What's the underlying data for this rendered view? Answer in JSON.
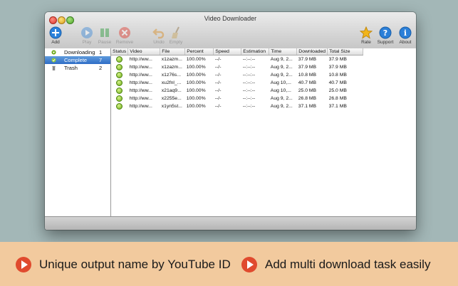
{
  "window": {
    "title": "Video Downloader"
  },
  "toolbar": {
    "add": "Add",
    "play": "Play",
    "pause": "Pause",
    "remove": "Remove",
    "undo": "Undo",
    "empty": "Empty",
    "rate": "Rate",
    "support": "Support",
    "about": "About"
  },
  "sidebar": {
    "items": [
      {
        "label": "Downloading",
        "count": "1",
        "icon": "download-status-icon"
      },
      {
        "label": "Complete",
        "count": "7",
        "icon": "complete-status-icon"
      },
      {
        "label": "Trash",
        "count": "2",
        "icon": "trash-icon"
      }
    ]
  },
  "table": {
    "columns": [
      "Status",
      "Video",
      "File",
      "Percent",
      "Speed",
      "Estimation",
      "Time",
      "Downloaded",
      "Total Size"
    ],
    "rows": [
      [
        "",
        "http://ww...",
        "x1zazm...",
        "100.00%",
        "--/-",
        "--:--:--",
        "Aug 9, 2...",
        "37.9 MB",
        "37.9 MB"
      ],
      [
        "",
        "http://ww...",
        "x1zazm...",
        "100.00%",
        "--/-",
        "--:--:--",
        "Aug 9, 2...",
        "37.9 MB",
        "37.9 MB"
      ],
      [
        "",
        "http://ww...",
        "x1z76s...",
        "100.00%",
        "--/-",
        "--:--:--",
        "Aug 9, 2...",
        "10.8 MB",
        "10.8 MB"
      ],
      [
        "",
        "http://ww...",
        "xu2fnl_...",
        "100.00%",
        "--/-",
        "--:--:--",
        "Aug 10,...",
        "40.7 MB",
        "40.7 MB"
      ],
      [
        "",
        "http://ww...",
        "x21aq9...",
        "100.00%",
        "--/-",
        "--:--:--",
        "Aug 10,...",
        "25.0 MB",
        "25.0 MB"
      ],
      [
        "",
        "http://ww...",
        "x2255e...",
        "100.00%",
        "--/-",
        "--:--:--",
        "Aug 9, 2...",
        "26.8 MB",
        "26.8 MB"
      ],
      [
        "",
        "http://ww...",
        "x1yn5st...",
        "100.00%",
        "--/-",
        "--:--:--",
        "Aug 9, 2...",
        "37.1 MB",
        "37.1 MB"
      ]
    ]
  },
  "promo": {
    "left": "Unique output name by YouTube ID",
    "right": "Add multi download task easily"
  },
  "colors": {
    "background": "#a3b7b7",
    "promo_band": "#f2ca9e",
    "play_accent": "#e04a2e",
    "selection": "#2f6ec6"
  }
}
